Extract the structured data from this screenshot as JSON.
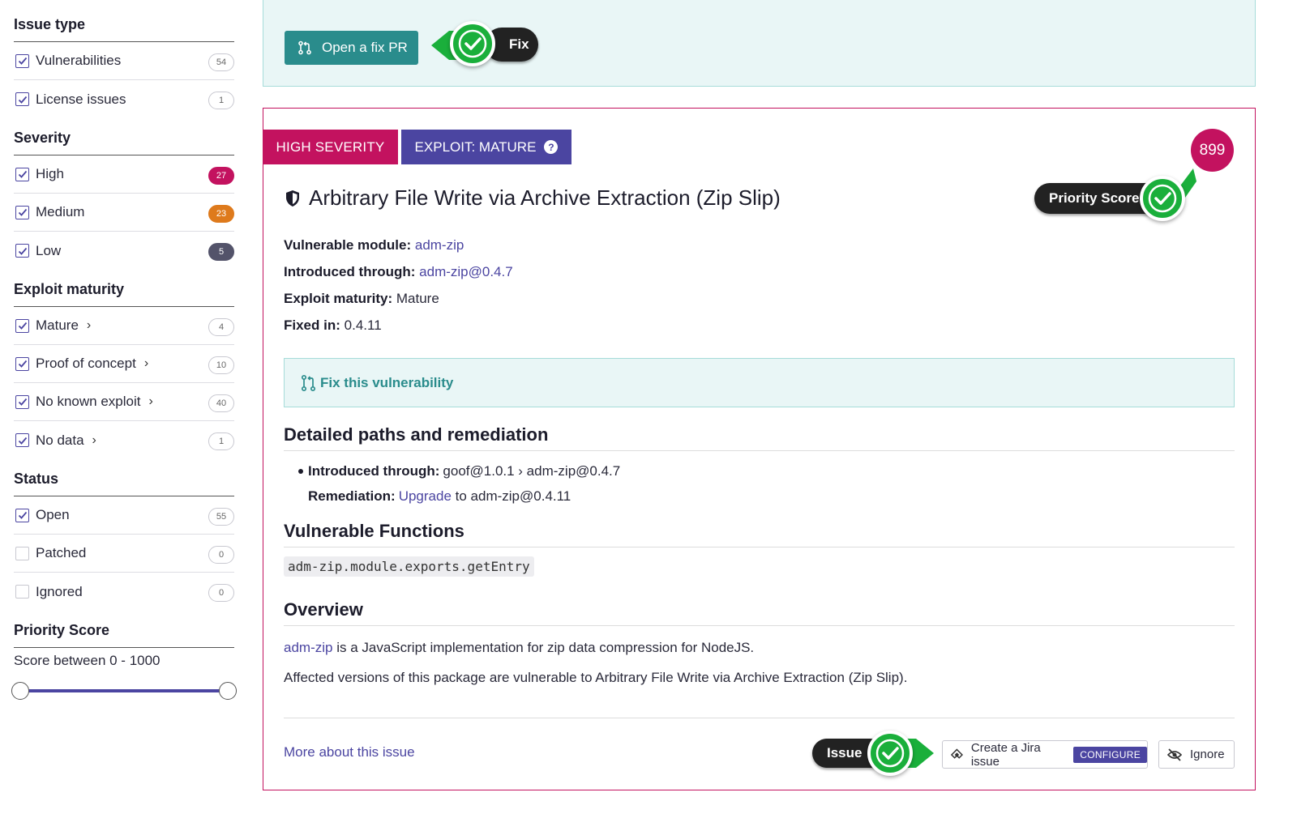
{
  "sidebar": {
    "issue_type": {
      "title": "Issue type",
      "items": [
        {
          "label": "Vulnerabilities",
          "count": "54",
          "checked": true
        },
        {
          "label": "License issues",
          "count": "1",
          "checked": true
        }
      ]
    },
    "severity": {
      "title": "Severity",
      "items": [
        {
          "label": "High",
          "count": "27",
          "checked": true
        },
        {
          "label": "Medium",
          "count": "23",
          "checked": true
        },
        {
          "label": "Low",
          "count": "5",
          "checked": true
        }
      ]
    },
    "exploit_maturity": {
      "title": "Exploit maturity",
      "items": [
        {
          "label": "Mature",
          "count": "4",
          "checked": true
        },
        {
          "label": "Proof of concept",
          "count": "10",
          "checked": true
        },
        {
          "label": "No known exploit",
          "count": "40",
          "checked": true
        },
        {
          "label": "No data",
          "count": "1",
          "checked": true
        }
      ]
    },
    "status": {
      "title": "Status",
      "items": [
        {
          "label": "Open",
          "count": "55",
          "checked": true
        },
        {
          "label": "Patched",
          "count": "0",
          "checked": false
        },
        {
          "label": "Ignored",
          "count": "0",
          "checked": false
        }
      ]
    },
    "priority_score": {
      "title": "Priority Score",
      "range_label": "Score between 0 - 1000"
    }
  },
  "fix_panel": {
    "button_label": "Open a fix PR"
  },
  "callouts": {
    "fix": "Fix",
    "priority_score": "Priority Score",
    "issue": "Issue"
  },
  "issue": {
    "severity_badge": "HIGH SEVERITY",
    "exploit_badge": "EXPLOIT: MATURE",
    "priority_score": "899",
    "title": "Arbitrary File Write via Archive Extraction (Zip Slip)",
    "vulnerable_module_label": "Vulnerable module:",
    "vulnerable_module": "adm-zip",
    "introduced_through_label": "Introduced through:",
    "introduced_through": "adm-zip@0.4.7",
    "exploit_maturity_label": "Exploit maturity:",
    "exploit_maturity": "Mature",
    "fixed_in_label": "Fixed in:",
    "fixed_in": "0.4.11",
    "fix_vulnerability_label": "Fix this vulnerability",
    "paths_heading": "Detailed paths and remediation",
    "path_introduced_label": "Introduced through:",
    "path_introduced": "goof@1.0.1 › adm-zip@0.4.7",
    "remediation_label": "Remediation:",
    "remediation_link": "Upgrade",
    "remediation_text": "to adm-zip@0.4.11",
    "functions_heading": "Vulnerable Functions",
    "function_name": "adm-zip.module.exports.getEntry",
    "overview_heading": "Overview",
    "overview_link": "adm-zip",
    "overview_line1": "is a JavaScript implementation for zip data compression for NodeJS.",
    "overview_line2": "Affected versions of this package are vulnerable to Arbitrary File Write via Archive Extraction (Zip Slip).",
    "more_link": "More about this issue",
    "jira_label": "Create a Jira issue",
    "configure_label": "CONFIGURE",
    "ignore_label": "Ignore"
  },
  "colors": {
    "high": "#c3125f",
    "medium": "#de7a1c",
    "low": "#53536a",
    "brand_purple": "#4b45a1",
    "teal": "#2a8c8c",
    "callout_green": "#1aaf3b"
  },
  "icons": [
    "checkbox-check-icon",
    "chevron-right-icon",
    "pull-request-icon",
    "shield-icon",
    "help-icon",
    "jira-icon",
    "eye-slash-icon",
    "green-check-icon"
  ]
}
